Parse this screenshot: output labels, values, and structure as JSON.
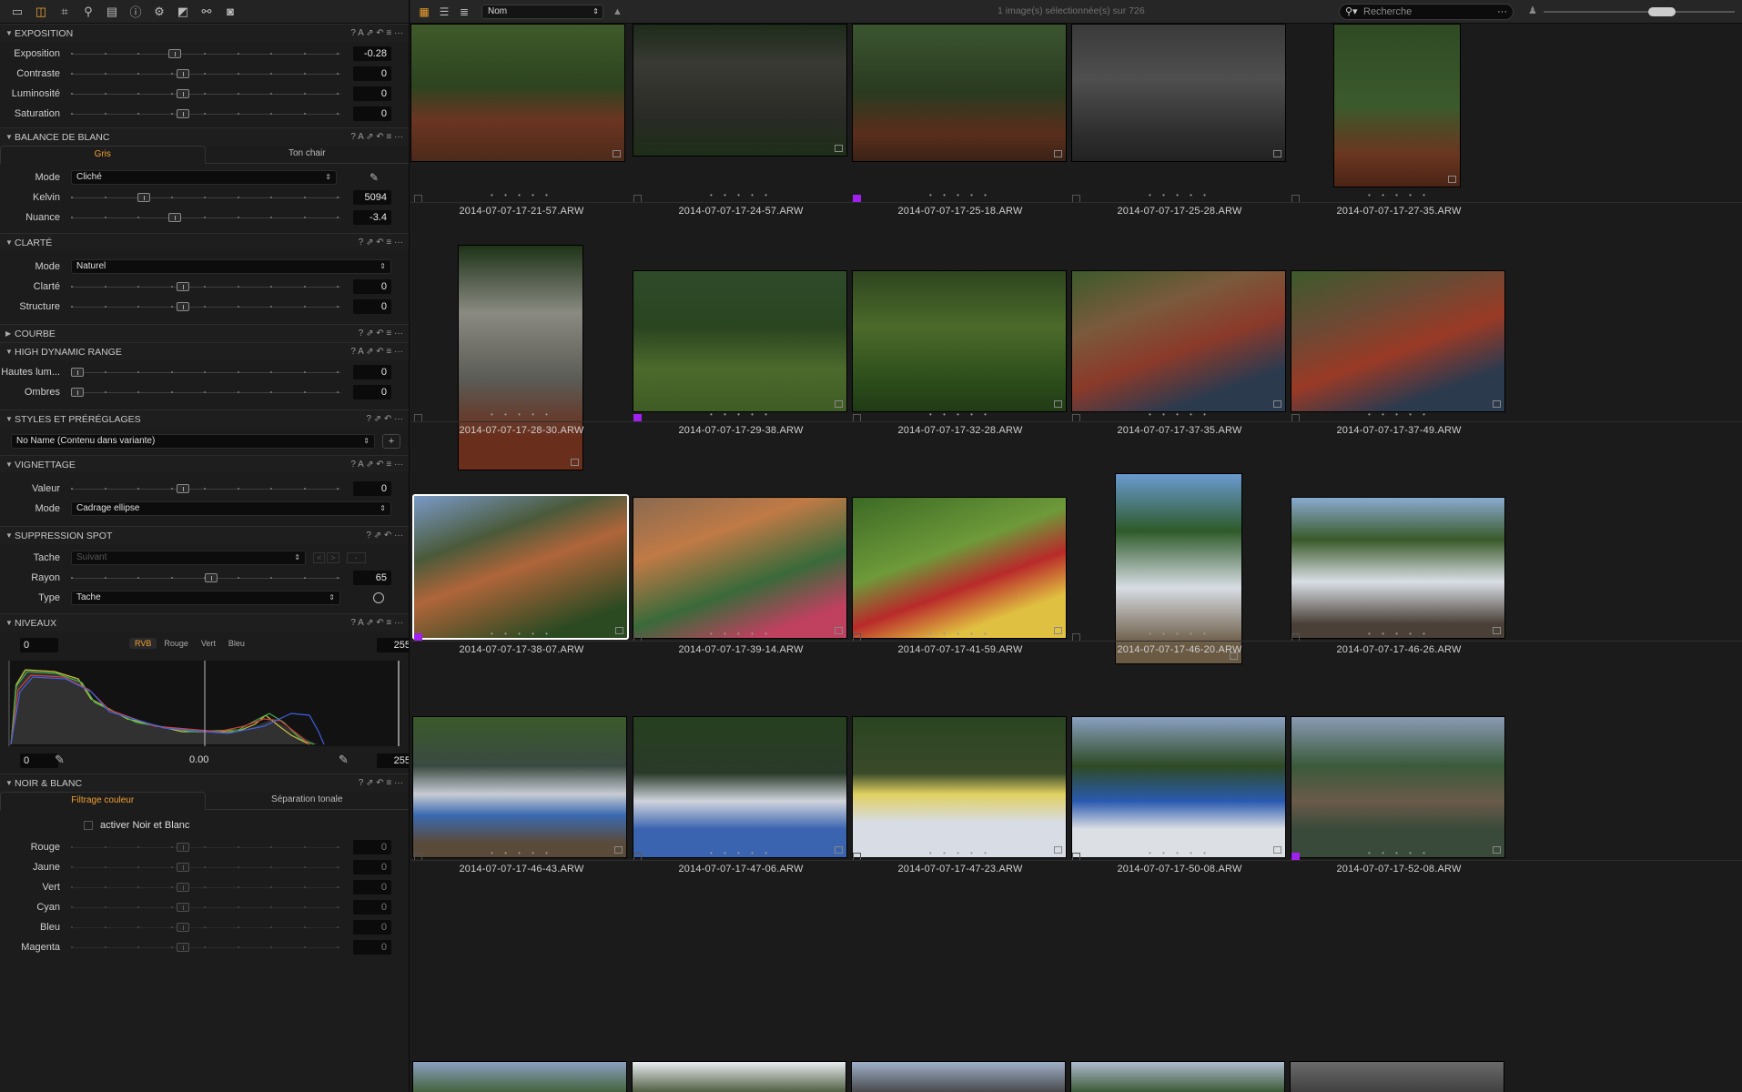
{
  "left_panel": {
    "tool_tabs": [
      "folder-icon",
      "adjust-icon",
      "crop-icon",
      "search-icon",
      "document-icon",
      "info-icon",
      "gear-icon",
      "levels-icon",
      "settings-icon",
      "camera-icon"
    ],
    "exposition": {
      "title": "EXPOSITION",
      "rows": [
        {
          "label": "Exposition",
          "value": "-0.28",
          "level": 0.38
        },
        {
          "label": "Contraste",
          "value": "0",
          "level": 0.41
        },
        {
          "label": "Luminosité",
          "value": "0",
          "level": 0.41
        },
        {
          "label": "Saturation",
          "value": "0",
          "level": 0.41
        }
      ]
    },
    "balance": {
      "title": "BALANCE DE BLANC",
      "tabs": [
        "Gris",
        "Ton chair"
      ],
      "mode_label": "Mode",
      "mode_value": "Cliché",
      "rows": [
        {
          "label": "Kelvin",
          "value": "5094",
          "level": 0.26
        },
        {
          "label": "Nuance",
          "value": "-3.4",
          "level": 0.38
        }
      ]
    },
    "clarte": {
      "title": "CLARTÉ",
      "mode_label": "Mode",
      "mode_value": "Naturel",
      "rows": [
        {
          "label": "Clarté",
          "value": "0",
          "level": 0.41
        },
        {
          "label": "Structure",
          "value": "0",
          "level": 0.41
        }
      ]
    },
    "courbe": {
      "title": "COURBE"
    },
    "hdr": {
      "title": "HIGH DYNAMIC RANGE",
      "rows": [
        {
          "label": "Hautes lum...",
          "value": "0",
          "level": 0.0
        },
        {
          "label": "Ombres",
          "value": "0",
          "level": 0.0
        }
      ]
    },
    "styles": {
      "title": "STYLES ET PRÉRÉGLAGES",
      "value": "No Name (Contenu dans variante)"
    },
    "vignettage": {
      "title": "VIGNETTAGE",
      "rows": [
        {
          "label": "Valeur",
          "value": "0",
          "level": 0.41
        }
      ],
      "mode_label": "Mode",
      "mode_value": "Cadrage ellipse"
    },
    "spot": {
      "title": "SUPPRESSION SPOT",
      "tache_label": "Tache",
      "tache_value": "Suivant",
      "rayon_label": "Rayon",
      "rayon_value": "65",
      "rayon_level": 0.52,
      "type_label": "Type",
      "type_value": "Tache"
    },
    "niveaux": {
      "title": "NIVEAUX",
      "channels": [
        "RVB",
        "Rouge",
        "Vert",
        "Bleu"
      ],
      "in_low": "0",
      "in_high": "255",
      "out_low": "0",
      "out_mid": "0.00",
      "out_high": "255"
    },
    "noir_blanc": {
      "title": "NOIR & BLANC",
      "tabs": [
        "Filtrage couleur",
        "Séparation tonale"
      ],
      "activate_label": "activer Noir et Blanc",
      "rows": [
        {
          "label": "Rouge",
          "value": "0"
        },
        {
          "label": "Jaune",
          "value": "0"
        },
        {
          "label": "Vert",
          "value": "0"
        },
        {
          "label": "Cyan",
          "value": "0"
        },
        {
          "label": "Bleu",
          "value": "0"
        },
        {
          "label": "Magenta",
          "value": "0"
        }
      ]
    }
  },
  "browser": {
    "sort_value": "Nom",
    "count_text": "1 image(s) sélectionnée(s) sur 726",
    "search_placeholder": "Recherche",
    "stars": "• • • • •",
    "rows": [
      [
        "2014-07-07-17-21-57.ARW",
        "2014-07-07-17-24-57.ARW",
        "2014-07-07-17-25-18.ARW",
        "2014-07-07-17-25-28.ARW",
        "2014-07-07-17-27-35.ARW"
      ],
      [
        "2014-07-07-17-28-30.ARW",
        "2014-07-07-17-29-38.ARW",
        "2014-07-07-17-32-28.ARW",
        "2014-07-07-17-37-35.ARW",
        "2014-07-07-17-37-49.ARW"
      ],
      [
        "2014-07-07-17-38-07.ARW",
        "2014-07-07-17-39-14.ARW",
        "2014-07-07-17-41-59.ARW",
        "2014-07-07-17-46-20.ARW",
        "2014-07-07-17-46-26.ARW"
      ],
      [
        "2014-07-07-17-46-43.ARW",
        "2014-07-07-17-47-06.ARW",
        "2014-07-07-17-47-23.ARW",
        "2014-07-07-17-50-08.ARW",
        "2014-07-07-17-52-08.ARW"
      ]
    ],
    "purple_labels": [
      [
        0,
        2
      ],
      [
        1,
        1
      ],
      [
        2,
        0
      ],
      [
        3,
        4
      ]
    ]
  }
}
